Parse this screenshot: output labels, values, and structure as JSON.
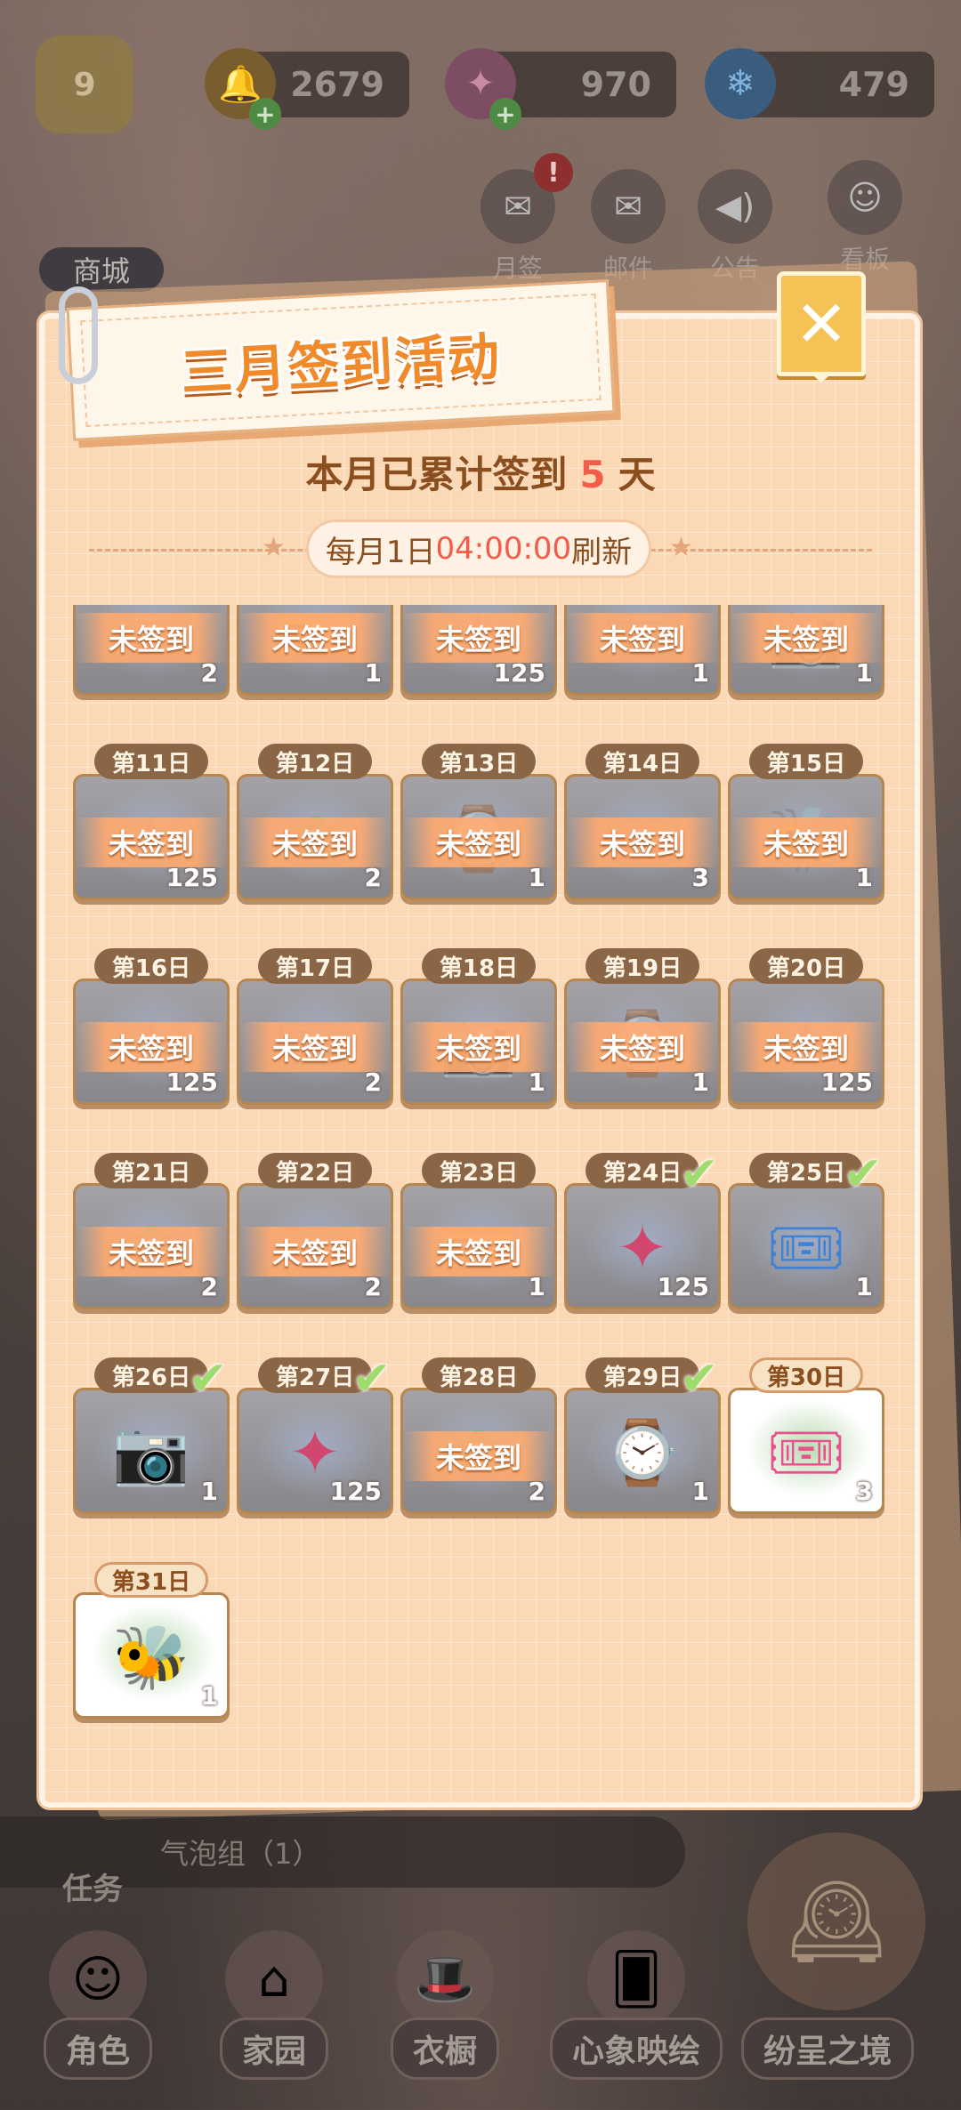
{
  "header": {
    "level": "9",
    "currencies": [
      {
        "icon": "gold-bell-icon",
        "value": "2679"
      },
      {
        "icon": "pink-gem-icon",
        "value": "970"
      },
      {
        "icon": "blue-snowflake-icon",
        "value": "479"
      }
    ],
    "shop_label": "商城",
    "side_buttons": [
      {
        "label": "月签",
        "icon": "envelope-icon",
        "badge": "!"
      },
      {
        "label": "邮件",
        "icon": "mail-icon"
      },
      {
        "label": "公告",
        "icon": "speaker-icon"
      },
      {
        "label": "看板",
        "icon": "character-icon"
      }
    ]
  },
  "modal": {
    "title": "三月签到活动",
    "summary_prefix": "本月已累计签到",
    "summary_count": "5",
    "summary_suffix": "天",
    "refresh_prefix": "每月1日",
    "refresh_time": "04:00:00",
    "refresh_suffix": "刷新",
    "close_symbol": "✕",
    "unsigned_label": "未签到",
    "days": [
      {
        "day": "",
        "qty": "2",
        "icon": "ticket",
        "status": "unsigned"
      },
      {
        "day": "",
        "qty": "1",
        "icon": "ticket-red",
        "status": "unsigned"
      },
      {
        "day": "",
        "qty": "125",
        "icon": "star-gem",
        "status": "unsigned"
      },
      {
        "day": "",
        "qty": "1",
        "icon": "blue-ticket",
        "status": "unsigned"
      },
      {
        "day": "",
        "qty": "1",
        "icon": "camera",
        "status": "unsigned"
      },
      {
        "day": "第11日",
        "qty": "125",
        "icon": "star-gem",
        "status": "unsigned"
      },
      {
        "day": "第12日",
        "qty": "2",
        "icon": "green-item",
        "status": "unsigned"
      },
      {
        "day": "第13日",
        "qty": "1",
        "icon": "watch",
        "status": "unsigned"
      },
      {
        "day": "第14日",
        "qty": "3",
        "icon": "ticket",
        "status": "unsigned"
      },
      {
        "day": "第15日",
        "qty": "1",
        "icon": "bee",
        "status": "unsigned"
      },
      {
        "day": "第16日",
        "qty": "125",
        "icon": "star-gem",
        "status": "unsigned"
      },
      {
        "day": "第17日",
        "qty": "2",
        "icon": "blue-ticket",
        "status": "unsigned"
      },
      {
        "day": "第18日",
        "qty": "1",
        "icon": "camera",
        "status": "unsigned"
      },
      {
        "day": "第19日",
        "qty": "1",
        "icon": "watch",
        "status": "unsigned"
      },
      {
        "day": "第20日",
        "qty": "125",
        "icon": "star-gem",
        "status": "unsigned"
      },
      {
        "day": "第21日",
        "qty": "2",
        "icon": "green-item",
        "status": "unsigned"
      },
      {
        "day": "第22日",
        "qty": "2",
        "icon": "ticket",
        "status": "unsigned"
      },
      {
        "day": "第23日",
        "qty": "1",
        "icon": "ticket-red",
        "status": "unsigned"
      },
      {
        "day": "第24日",
        "qty": "125",
        "icon": "star-gem",
        "status": "signed"
      },
      {
        "day": "第25日",
        "qty": "1",
        "icon": "blue-ticket",
        "status": "signed"
      },
      {
        "day": "第26日",
        "qty": "1",
        "icon": "camera",
        "status": "signed"
      },
      {
        "day": "第27日",
        "qty": "125",
        "icon": "star-gem",
        "status": "signed"
      },
      {
        "day": "第28日",
        "qty": "2",
        "icon": "green-item",
        "status": "unsigned"
      },
      {
        "day": "第29日",
        "qty": "1",
        "icon": "watch",
        "status": "signed"
      },
      {
        "day": "第30日",
        "qty": "3",
        "icon": "pink-ticket",
        "status": "available"
      },
      {
        "day": "第31日",
        "qty": "1",
        "icon": "bee-golf",
        "status": "available"
      }
    ]
  },
  "footer": {
    "task_label": "任务",
    "task_bar_text": "气泡组（1）",
    "nav": [
      {
        "label": "角色",
        "icon": "character-icon"
      },
      {
        "label": "家园",
        "icon": "house-icon"
      },
      {
        "label": "衣橱",
        "icon": "hat-icon"
      },
      {
        "label": "心象映绘",
        "icon": "cards-icon"
      },
      {
        "label": "纷呈之境",
        "icon": "clock-icon"
      }
    ]
  },
  "colors": {
    "accent_red": "#f35b4a",
    "title_orange": "#f08a2a",
    "panel_bg": "#fcd9b6",
    "check_green": "#9fdc6e"
  }
}
